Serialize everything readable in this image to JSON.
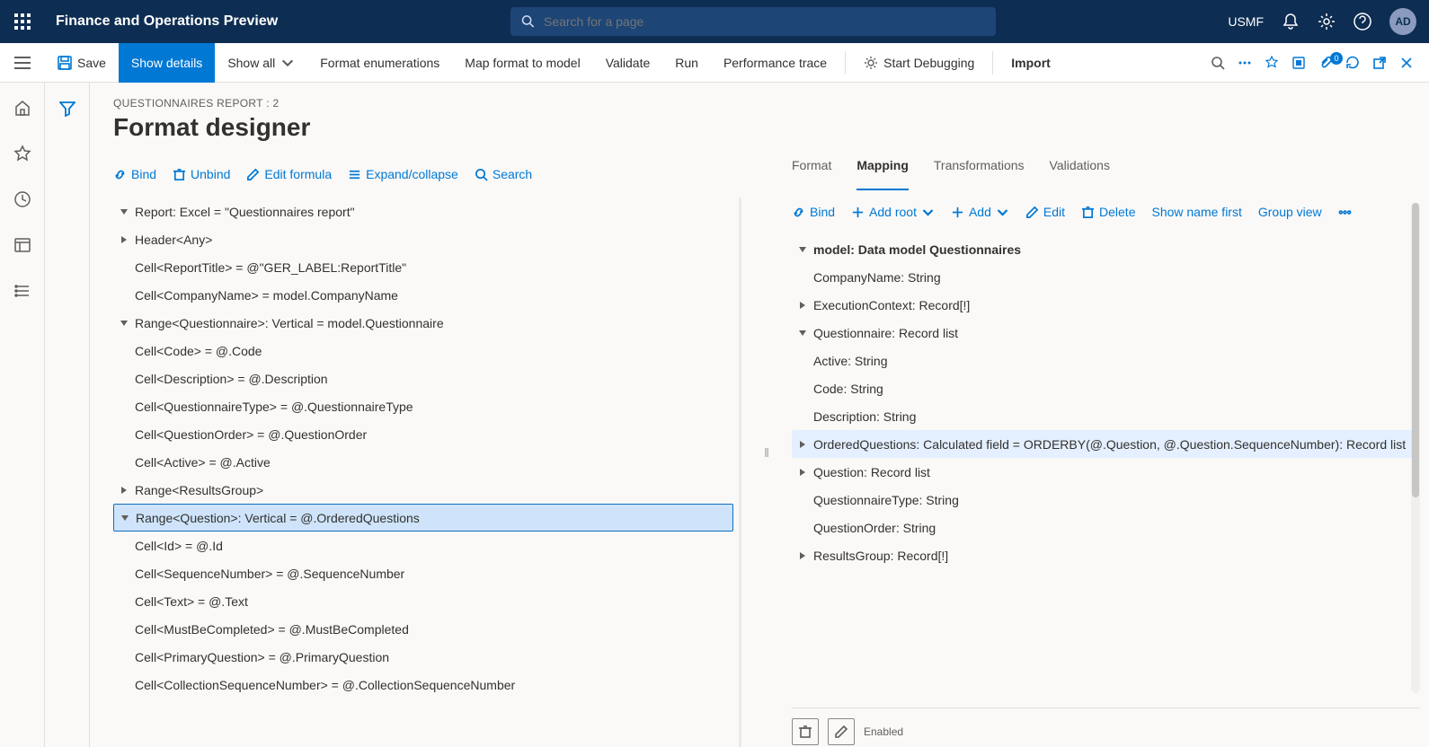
{
  "header": {
    "title": "Finance and Operations Preview",
    "search_placeholder": "Search for a page",
    "entity": "USMF",
    "avatar": "AD"
  },
  "actions": {
    "save": "Save",
    "show_details": "Show details",
    "show_all": "Show all",
    "format_enum": "Format enumerations",
    "map": "Map format to model",
    "validate": "Validate",
    "run": "Run",
    "perf": "Performance trace",
    "debug": "Start Debugging",
    "import": "Import",
    "attach_count": "0"
  },
  "page": {
    "crumb": "QUESTIONNAIRES REPORT : 2",
    "title": "Format designer"
  },
  "left_toolbar": {
    "bind": "Bind",
    "unbind": "Unbind",
    "edit": "Edit formula",
    "expand": "Expand/collapse",
    "search": "Search"
  },
  "left_tree": [
    {
      "d": 0,
      "a": "down",
      "t": "Report: Excel = \"Questionnaires report\""
    },
    {
      "d": 1,
      "a": "right",
      "t": "Header<Any>"
    },
    {
      "d": 2,
      "a": "",
      "t": "Cell<ReportTitle> = @\"GER_LABEL:ReportTitle\""
    },
    {
      "d": 2,
      "a": "",
      "t": "Cell<CompanyName> = model.CompanyName"
    },
    {
      "d": 1,
      "a": "down",
      "t": "Range<Questionnaire>: Vertical = model.Questionnaire"
    },
    {
      "d": 2,
      "a": "",
      "t": "Cell<Code> = @.Code"
    },
    {
      "d": 2,
      "a": "",
      "t": "Cell<Description> = @.Description"
    },
    {
      "d": 2,
      "a": "",
      "t": "Cell<QuestionnaireType> = @.QuestionnaireType"
    },
    {
      "d": 2,
      "a": "",
      "t": "Cell<QuestionOrder> = @.QuestionOrder"
    },
    {
      "d": 2,
      "a": "",
      "t": "Cell<Active> = @.Active"
    },
    {
      "d": 2,
      "a": "right",
      "t": "Range<ResultsGroup>"
    },
    {
      "d": 2,
      "a": "down",
      "t": "Range<Question>: Vertical = @.OrderedQuestions",
      "sel": true
    },
    {
      "d": 3,
      "a": "",
      "t": "Cell<Id> = @.Id"
    },
    {
      "d": 3,
      "a": "",
      "t": "Cell<SequenceNumber> = @.SequenceNumber"
    },
    {
      "d": 3,
      "a": "",
      "t": "Cell<Text> = @.Text"
    },
    {
      "d": 3,
      "a": "",
      "t": "Cell<MustBeCompleted> = @.MustBeCompleted"
    },
    {
      "d": 3,
      "a": "",
      "t": "Cell<PrimaryQuestion> = @.PrimaryQuestion"
    },
    {
      "d": 3,
      "a": "",
      "t": "Cell<CollectionSequenceNumber> = @.CollectionSequenceNumber"
    }
  ],
  "tabs": {
    "format": "Format",
    "mapping": "Mapping",
    "transform": "Transformations",
    "valid": "Validations"
  },
  "right_toolbar": {
    "bind": "Bind",
    "add_root": "Add root",
    "add": "Add",
    "edit": "Edit",
    "delete": "Delete",
    "show_name": "Show name first",
    "group": "Group view"
  },
  "right_tree": [
    {
      "d": 0,
      "a": "down",
      "t": "model: Data model Questionnaires",
      "bold": true
    },
    {
      "d": 1,
      "a": "",
      "t": "CompanyName: String"
    },
    {
      "d": 1,
      "a": "right",
      "t": "ExecutionContext: Record[!]"
    },
    {
      "d": 1,
      "a": "down",
      "t": "Questionnaire: Record list"
    },
    {
      "d": 2,
      "a": "",
      "t": "Active: String"
    },
    {
      "d": 2,
      "a": "",
      "t": "Code: String"
    },
    {
      "d": 2,
      "a": "",
      "t": "Description: String"
    },
    {
      "d": 2,
      "a": "right",
      "t": "OrderedQuestions: Calculated field = ORDERBY(@.Question, @.Question.SequenceNumber): Record list",
      "sel2": true
    },
    {
      "d": 2,
      "a": "right",
      "t": "Question: Record list"
    },
    {
      "d": 2,
      "a": "",
      "t": "QuestionnaireType: String"
    },
    {
      "d": 2,
      "a": "",
      "t": "QuestionOrder: String"
    },
    {
      "d": 1,
      "a": "right",
      "t": "ResultsGroup: Record[!]"
    }
  ],
  "footer": {
    "enabled": "Enabled"
  }
}
